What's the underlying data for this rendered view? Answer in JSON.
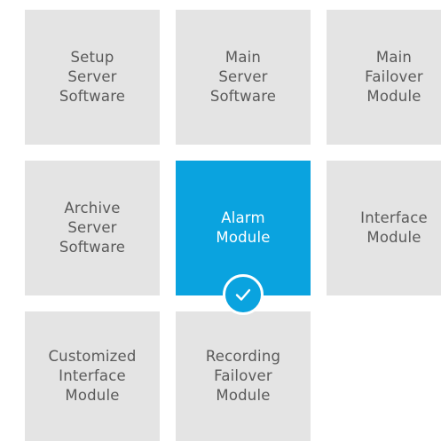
{
  "tiles": [
    {
      "lines": [
        "Setup",
        "Server",
        "Software"
      ],
      "selected": false
    },
    {
      "lines": [
        "Main",
        "Server",
        "Software"
      ],
      "selected": false
    },
    {
      "lines": [
        "Main",
        "Failover",
        "Module"
      ],
      "selected": false
    },
    {
      "lines": [
        "Archive",
        "Server",
        "Software"
      ],
      "selected": false
    },
    {
      "lines": [
        "Alarm",
        "Module"
      ],
      "selected": true
    },
    {
      "lines": [
        "Interface",
        "Module"
      ],
      "selected": false
    },
    {
      "lines": [
        "Customized",
        "Interface",
        "Module"
      ],
      "selected": false
    },
    {
      "lines": [
        "Recording",
        "Failover",
        "Module"
      ],
      "selected": false
    }
  ],
  "colors": {
    "tile_bg": "#e4e4e4",
    "tile_text": "#5a5a5a",
    "selected_bg": "#0aa3df",
    "selected_text": "#ffffff"
  },
  "icons": {
    "selected_badge": "checkmark-icon"
  }
}
